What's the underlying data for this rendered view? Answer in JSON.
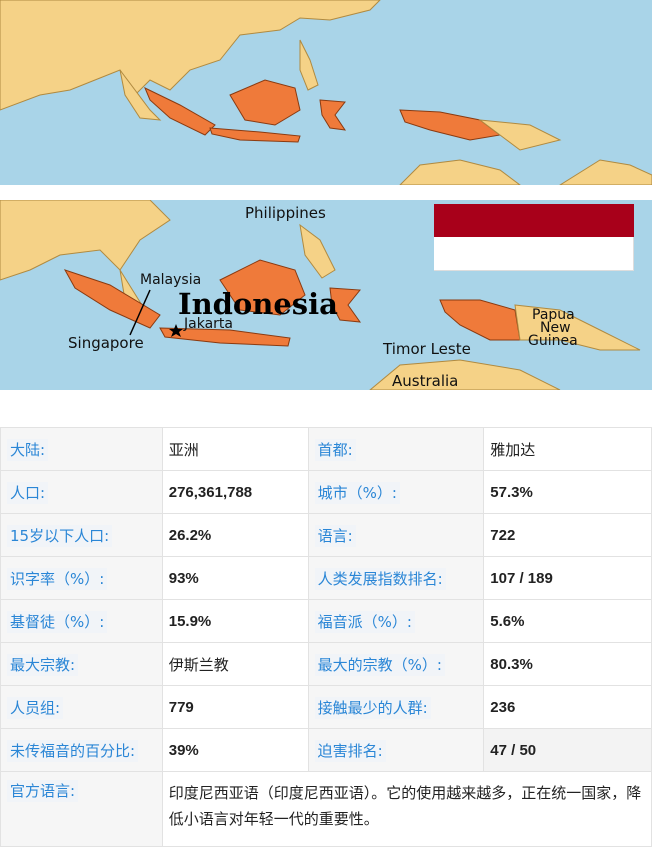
{
  "map_top": {
    "colors": {
      "sea": "#a9d4e8",
      "land": "#f5d287",
      "highlight": "#ef7a3a"
    }
  },
  "map_bottom": {
    "labels": {
      "philippines": "Philippines",
      "malaysia": "Malaysia",
      "indonesia": "Indonesia",
      "jakarta": "Jakarta",
      "singapore": "Singapore",
      "papua": "Papua",
      "new": "New",
      "guinea": "Guinea",
      "timor": "Timor Leste",
      "australia": "Australia"
    }
  },
  "flag": {
    "colors": {
      "top": "#a8001a",
      "bottom": "#ffffff"
    }
  },
  "info": {
    "rows": [
      {
        "k1": "大陆:",
        "v1": "亚洲",
        "k2": "首都:",
        "v2": "雅加达"
      },
      {
        "k1": "人口:",
        "v1": "276,361,788",
        "k2": "城市（%）:",
        "v2": "57.3%"
      },
      {
        "k1": "15岁以下人口:",
        "v1": "26.2%",
        "k2": "语言:",
        "v2": "722"
      },
      {
        "k1": "识字率（%）:",
        "v1": "93%",
        "k2": "人类发展指数排名:",
        "v2": "107 / 189"
      },
      {
        "k1": "基督徒（%）:",
        "v1": "15.9%",
        "k2": "福音派（%）:",
        "v2": "5.6%"
      },
      {
        "k1": "最大宗教:",
        "v1": "伊斯兰教",
        "k2": "最大的宗教（%）:",
        "v2": "80.3%"
      },
      {
        "k1": "人员组:",
        "v1": "779",
        "k2": "接触最少的人群:",
        "v2": "236"
      },
      {
        "k1": "未传福音的百分比:",
        "v1": "39%",
        "k2": "迫害排名:",
        "v2": "47 / 50"
      }
    ],
    "official_language": {
      "label": "官方语言:",
      "value": "印度尼西亚语（印度尼西亚语）。它的使用越来越多，正在统一国家，降低小语言对年轻一代的重要性。"
    }
  }
}
